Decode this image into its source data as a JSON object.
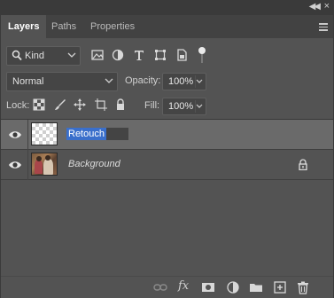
{
  "tabs": [
    {
      "label": "Layers",
      "active": true
    },
    {
      "label": "Paths",
      "active": false
    },
    {
      "label": "Properties",
      "active": false
    }
  ],
  "filter": {
    "kind_label": "Kind"
  },
  "blend": {
    "mode": "Normal"
  },
  "opacity": {
    "label": "Opacity:",
    "value": "100%"
  },
  "lock": {
    "label": "Lock:"
  },
  "fill": {
    "label": "Fill:",
    "value": "100%"
  },
  "layers": [
    {
      "name": "Retouch",
      "selected": true,
      "editing": true,
      "thumbnail": "transparent-checker",
      "locked": false
    },
    {
      "name": "Background",
      "selected": false,
      "editing": false,
      "thumbnail": "photo",
      "locked": true
    }
  ],
  "colors": {
    "panel": "#535353",
    "tabbar": "#424242",
    "selected_row": "#6a6a6a",
    "text_highlight": "#3a6fcb"
  },
  "icons": {
    "filter": [
      "image-filter-icon",
      "adjustment-filter-icon",
      "type-filter-icon",
      "shape-filter-icon",
      "smart-object-filter-icon"
    ],
    "lock": [
      "lock-transparent-pixels-icon",
      "lock-image-pixels-icon",
      "lock-position-icon",
      "lock-artboard-icon",
      "lock-all-icon"
    ],
    "bottom": [
      "link-layers-icon",
      "fx-icon",
      "add-mask-icon",
      "adjustment-layer-icon",
      "new-group-icon",
      "new-layer-icon",
      "delete-layer-icon"
    ]
  }
}
